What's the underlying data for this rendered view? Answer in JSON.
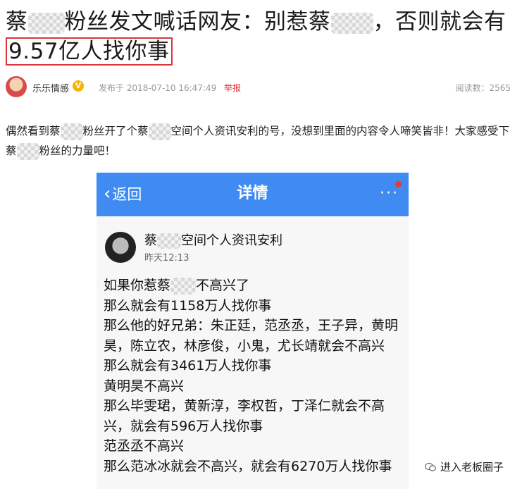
{
  "article": {
    "title_part1": "蔡",
    "title_part2": "粉丝发文喊话网友：别惹蔡",
    "title_part3": "，否则就会有",
    "title_highlight": "9.57亿人找你事",
    "author": "乐乐情感",
    "verified_badge": "V",
    "posted": "发布于 2018-07-10 16:47:49",
    "report": "举报",
    "views": "阅读数：2565",
    "para_part1": "偶然看到蔡",
    "para_part2": "粉丝开了个蔡",
    "para_part3": "空间个人资讯安利的号，没想到里面的内容令人啼笑皆非！大家感受下蔡",
    "para_part4": "粉丝的力量吧！"
  },
  "phone": {
    "back_label": "返回",
    "back_icon": "chevron-left-icon",
    "title": "详情",
    "more_icon": "more-dots-icon",
    "accent_color": "#3f8bf2",
    "poster_name_prefix": "蔡",
    "poster_name_suffix": "空间个人资讯安利",
    "post_time": "昨天12:13",
    "lines": [
      "如果你惹蔡",
      "不高兴了",
      "那么就会有1158万人找你事",
      "那么他的好兄弟：朱正廷，范丞丞，王子异，黄明昊，陈立农，林彦俊，小鬼，尤长靖就会不高兴",
      "那么就会有3461万人找你事",
      "黄明昊不高兴",
      "那么毕雯珺，黄新淳，李权哲，丁泽仁就会不高兴，就会有596万人找你事",
      "范丞丞不高兴",
      "那么范冰冰就会不高兴，就会有6270万人找你事"
    ]
  },
  "watermark": {
    "text": "进入老板圈子",
    "icon": "wechat-icon"
  }
}
